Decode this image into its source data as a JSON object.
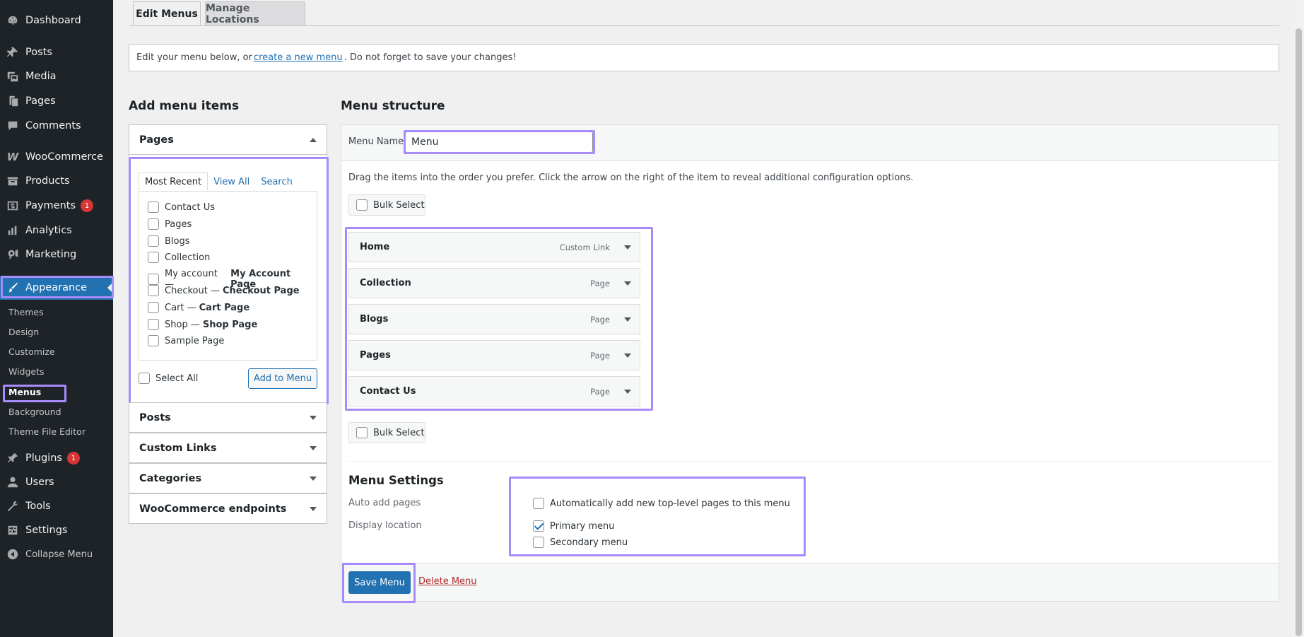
{
  "sidebar": {
    "items": [
      {
        "label": "Dashboard",
        "icon": "dashboard-icon"
      },
      {
        "label": "Posts",
        "icon": "pin-icon"
      },
      {
        "label": "Media",
        "icon": "media-icon"
      },
      {
        "label": "Pages",
        "icon": "pages-icon"
      },
      {
        "label": "Comments",
        "icon": "comment-icon"
      },
      {
        "label": "WooCommerce",
        "icon": "woocommerce-icon"
      },
      {
        "label": "Products",
        "icon": "archive-icon"
      },
      {
        "label": "Payments",
        "icon": "dollar-icon",
        "badge": "1"
      },
      {
        "label": "Analytics",
        "icon": "chart-bar-icon"
      },
      {
        "label": "Marketing",
        "icon": "megaphone-icon"
      },
      {
        "label": "Appearance",
        "icon": "paintbrush-icon"
      },
      {
        "label": "Plugins",
        "icon": "plugin-icon",
        "badge": "1"
      },
      {
        "label": "Users",
        "icon": "user-icon"
      },
      {
        "label": "Tools",
        "icon": "wrench-icon"
      },
      {
        "label": "Settings",
        "icon": "settings-icon"
      },
      {
        "label": "Collapse Menu",
        "icon": "collapse-icon"
      }
    ],
    "submenu": [
      "Themes",
      "Design",
      "Customize",
      "Widgets",
      "Menus",
      "Background",
      "Theme File Editor"
    ]
  },
  "tabs": {
    "edit": "Edit Menus",
    "manage": "Manage Locations"
  },
  "notice": {
    "before": "Edit your menu below, or",
    "link": "create a new menu",
    "after": ". Do not forget to save your changes!"
  },
  "add_items": {
    "title": "Add menu items",
    "pages_heading": "Pages",
    "tabs": [
      "Most Recent",
      "View All",
      "Search"
    ],
    "pages": [
      {
        "label": "Contact Us",
        "suffix": ""
      },
      {
        "label": "Pages",
        "suffix": ""
      },
      {
        "label": "Blogs",
        "suffix": ""
      },
      {
        "label": "Collection",
        "suffix": ""
      },
      {
        "label": "My account —",
        "suffix": "My Account Page"
      },
      {
        "label": "Checkout —",
        "suffix": "Checkout Page"
      },
      {
        "label": "Cart —",
        "suffix": "Cart Page"
      },
      {
        "label": "Shop —",
        "suffix": "Shop Page"
      },
      {
        "label": "Sample Page",
        "suffix": ""
      }
    ],
    "select_all": "Select All",
    "add_button": "Add to Menu",
    "sections": [
      "Posts",
      "Custom Links",
      "Categories",
      "WooCommerce endpoints"
    ]
  },
  "structure": {
    "title": "Menu structure",
    "name_label": "Menu Name",
    "name_value": "Menu",
    "instructions": "Drag the items into the order you prefer. Click the arrow on the right of the item to reveal additional configuration options.",
    "bulk_select": "Bulk Select",
    "items": [
      {
        "title": "Home",
        "type": "Custom Link"
      },
      {
        "title": "Collection",
        "type": "Page"
      },
      {
        "title": "Blogs",
        "type": "Page"
      },
      {
        "title": "Pages",
        "type": "Page"
      },
      {
        "title": "Contact Us",
        "type": "Page"
      }
    ]
  },
  "settings": {
    "title": "Menu Settings",
    "auto_add_label": "Auto add pages",
    "auto_add_option": "Automatically add new top-level pages to this menu",
    "display_label": "Display location",
    "locations": [
      {
        "label": "Primary menu",
        "checked": true
      },
      {
        "label": "Secondary menu",
        "checked": false
      }
    ]
  },
  "footer": {
    "save": "Save Menu",
    "delete": "Delete Menu"
  },
  "colors": {
    "accent": "#2271b1",
    "highlight": "#a78bfa",
    "sidebar": "#1d2327",
    "badge": "#d63638",
    "danger": "#b32d2e"
  }
}
